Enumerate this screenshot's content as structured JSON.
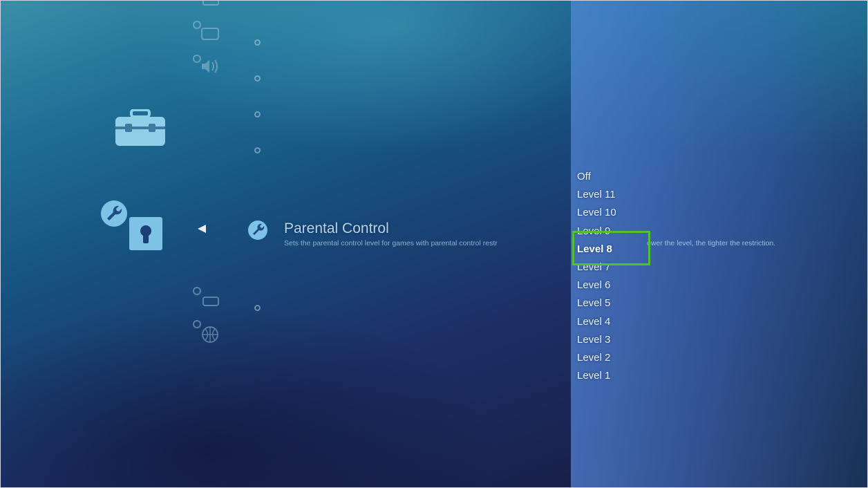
{
  "setting": {
    "title": "Parental Control",
    "description_part1": "Sets the parental control level for games with parental control restr",
    "description_part2": "ower the level, the tighter the restriction."
  },
  "options": [
    {
      "label": "Off"
    },
    {
      "label": "Level 11"
    },
    {
      "label": "Level 10"
    },
    {
      "label": "Level 9"
    },
    {
      "label": "Level 8",
      "selected": true
    },
    {
      "label": "Level 7"
    },
    {
      "label": "Level 6"
    },
    {
      "label": "Level 5"
    },
    {
      "label": "Level 4"
    },
    {
      "label": "Level 3"
    },
    {
      "label": "Level 2"
    },
    {
      "label": "Level 1"
    }
  ],
  "icons": {
    "category_main": "toolbox-icon",
    "category_security": "lock-icon",
    "category_security_badge": "wrench-icon",
    "item_current": "wrench-icon",
    "back": "arrow-left-icon"
  },
  "colors": {
    "selection_outline": "#4fc232",
    "option_text": "#e8f2ff",
    "title_text": "#b7d3e6"
  }
}
